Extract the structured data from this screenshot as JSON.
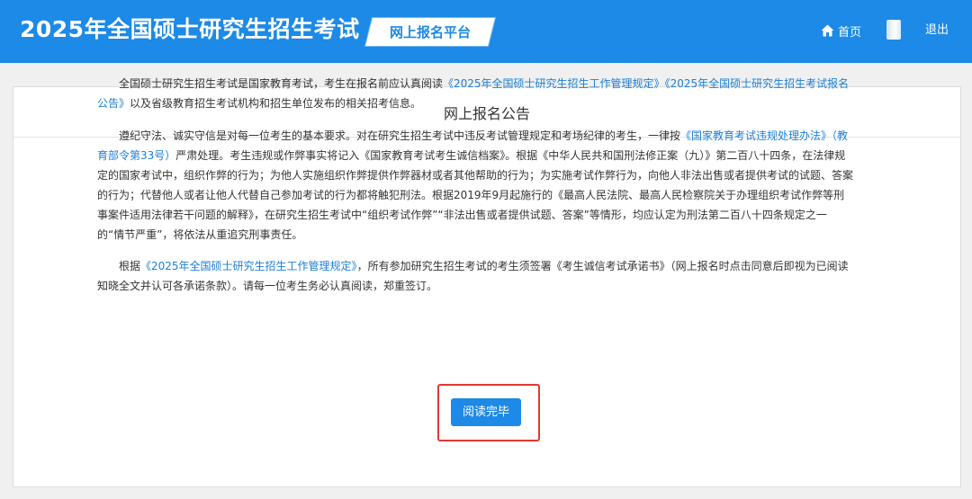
{
  "header": {
    "site_title": "2025年全国硕士研究生招生考试",
    "platform_label": "网上报名平台",
    "nav_home": "首页",
    "nav_logout": "退出"
  },
  "notice": {
    "title": "网上报名公告",
    "p1": {
      "t1": "全国硕士研究生招生考试是国家教育考试，考生在报名前应认真阅读",
      "l1": "《2025年全国硕士研究生招生工作管理规定》",
      "l2": "《2025年全国硕士研究生招生考试报名公告》",
      "t2": "以及省级教育招生考试机构和招生单位发布的相关招考信息。"
    },
    "p2": {
      "t1": "遵纪守法、诚实守信是对每一位考生的基本要求。对在研究生招生考试中违反考试管理规定和考场纪律的考生，一律按",
      "l1": "《国家教育考试违规处理办法》（教育部令第33号）",
      "t2": "严肃处理。考生违规或作弊事实将记入《国家教育考试考生诚信档案》。根据《中华人民共和国刑法修正案（九）》第二百八十四条，在法律规定的国家考试中，组织作弊的行为；为他人实施组织作弊提供作弊器材或者其他帮助的行为；为实施考试作弊行为，向他人非法出售或者提供考试的试题、答案的行为；代替他人或者让他人代替自己参加考试的行为都将触犯刑法。根据2019年9月起施行的《最高人民法院、最高人民检察院关于办理组织考试作弊等刑事案件适用法律若干问题的解释》，在研究生招生考试中“组织考试作弊”“非法出售或者提供试题、答案”等情形，均应认定为刑法第二百八十四条规定之一的“情节严重”，将依法从重追究刑事责任。"
    },
    "p3": {
      "t1": "根据",
      "l1": "《2025年全国硕士研究生招生工作管理规定》",
      "t2": "，所有参加研究生招生考试的考生须签署《考生诚信考试承诺书》（网上报名时点击同意后即视为已阅读知晓全文并认可各承诺条款）。请每一位考生务必认真阅读，郑重签订。"
    },
    "button_label": "阅读完毕"
  },
  "colors": {
    "header_bg": "#1c8ae6",
    "link": "#1c7fd6",
    "highlight": "#e03a2f"
  },
  "icons": {
    "home": "home-icon"
  }
}
